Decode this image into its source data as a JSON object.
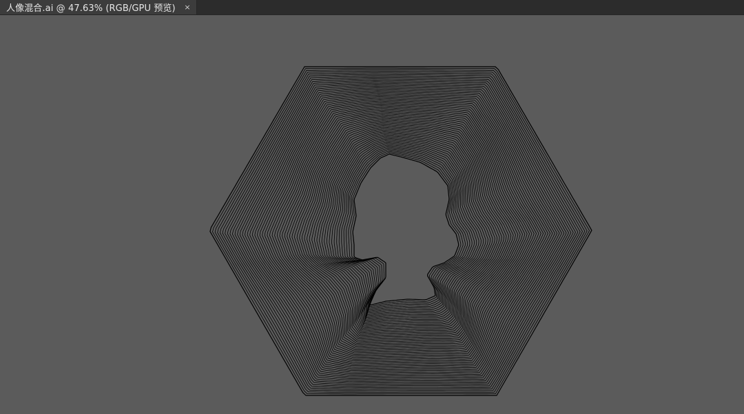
{
  "document_tab": {
    "title": "人像混合.ai @ 47.63% (RGB/GPU 预览)",
    "close_glyph": "×"
  },
  "artboard": {
    "background_color": "#5b5b5b",
    "stroke_color": "#000000",
    "blend_shape": "hexagon-to-portrait-silhouette"
  }
}
